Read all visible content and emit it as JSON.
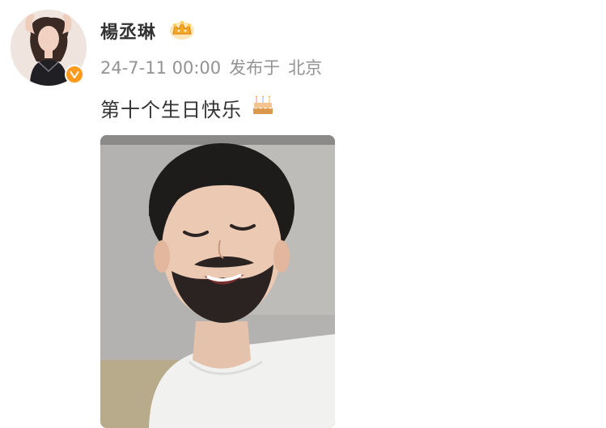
{
  "post": {
    "username": "楊丞琳",
    "timestamp": "24-7-11 00:00",
    "published_label": "发布于",
    "location": "北京",
    "text": "第十个生日快乐"
  },
  "icons": {
    "avatar": "avatar-image",
    "verified": "verified-badge-icon",
    "crown": "vip-crown-icon",
    "cake": "birthday-cake-emoji",
    "media": "post-photo"
  },
  "colors": {
    "username": "#333333",
    "meta": "#939393",
    "verified_badge": "#ff9a1f",
    "background": "#ffffff"
  }
}
